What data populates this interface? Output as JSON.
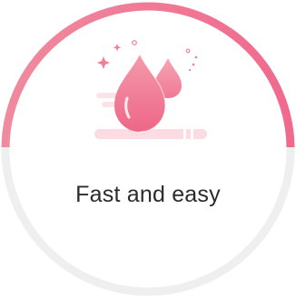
{
  "card": {
    "caption": "Fast and easy",
    "icon": "blood-drop-icon"
  },
  "colors": {
    "accent_start": "#f07f95",
    "accent_end": "#f26b8f",
    "ring_track": "#eeeeee",
    "caption_text": "#2b2b2b"
  }
}
